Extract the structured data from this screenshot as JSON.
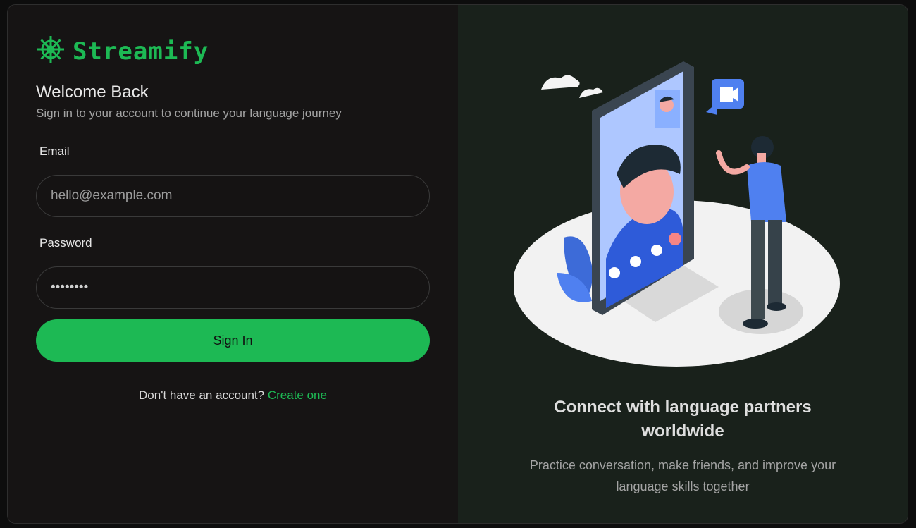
{
  "brand": {
    "name": "Streamify",
    "icon": "ship-wheel-icon",
    "color": "#1db954"
  },
  "login": {
    "heading": "Welcome Back",
    "subheading": "Sign in to your account to continue your language journey",
    "email_label": "Email",
    "email_placeholder": "hello@example.com",
    "email_value": "",
    "password_label": "Password",
    "password_value": "••••••••",
    "submit_label": "Sign In",
    "signup_prompt": "Don't have an account?",
    "signup_link": "Create one"
  },
  "promo": {
    "title": "Connect with language partners worldwide",
    "text": "Practice conversation, make friends, and improve your language skills together",
    "illustration": "video-call-illustration"
  },
  "colors": {
    "accent": "#1db954",
    "left_bg": "#161414",
    "right_bg": "#19211b"
  }
}
